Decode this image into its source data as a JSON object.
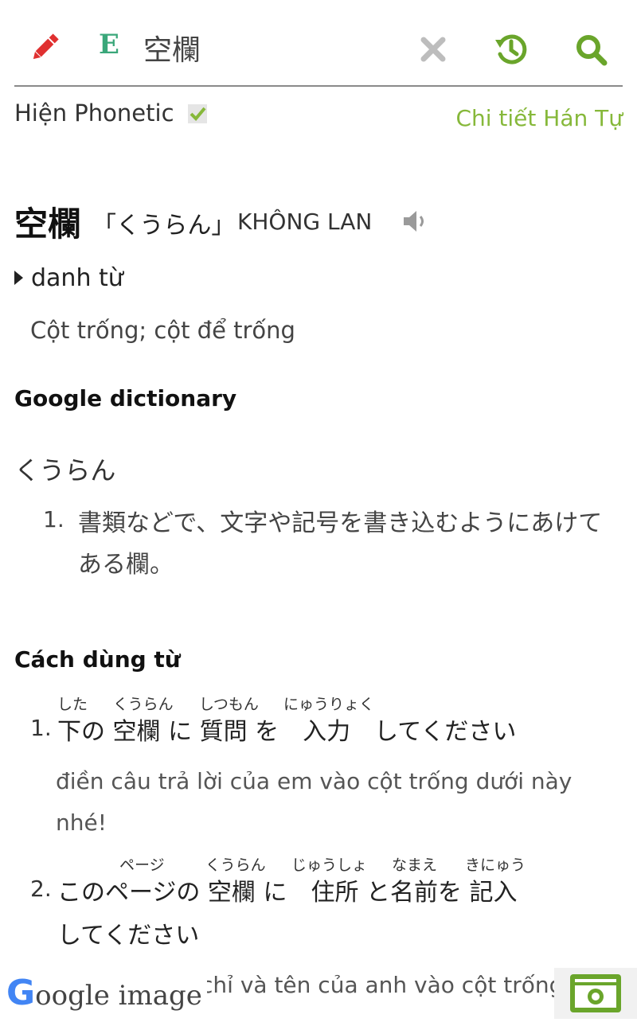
{
  "header": {
    "language_letter": "E",
    "query": "空欄"
  },
  "options": {
    "phonetic_label": "Hiện Phonetic",
    "detail_link": "Chi tiết Hán Tự"
  },
  "entry": {
    "headword": "空欄",
    "reading": "「くうらん」",
    "han_viet": "KHÔNG LAN",
    "part_of_speech": "danh từ",
    "meaning": "Cột trống; cột để trống"
  },
  "google": {
    "title": "Google dictionary",
    "reading": "くうらん",
    "def_number": "1.",
    "definition": "書類などで、文字や記号を書き込むようにあけてある欄。"
  },
  "usage": {
    "title": "Cách dùng từ",
    "examples": [
      {
        "number": "1.",
        "line1": "下の 空欄 に 質問 を　入力　してください",
        "ruby": [
          "した",
          "くうらん",
          "しつもん",
          "にゅうりょく"
        ],
        "translation": "điền câu trả lời của em vào cột trống dưới này nhé!"
      },
      {
        "number": "2.",
        "line1": "このページの 空欄 に　住所 と名前を 記入",
        "line2": "してください",
        "ruby": [
          "ページ",
          "くうらん",
          "じゅうしょ",
          "なまえ",
          "きにゅう"
        ],
        "translation": "chỉ và tên của anh vào cột trống"
      }
    ]
  },
  "footer": {
    "google_g": "G",
    "google_rest": "oogle image"
  },
  "colors": {
    "accent_green": "#86b83a",
    "icon_green": "#6aa52b",
    "pencil_red": "#e03030",
    "letter_teal": "#3aa77a"
  }
}
